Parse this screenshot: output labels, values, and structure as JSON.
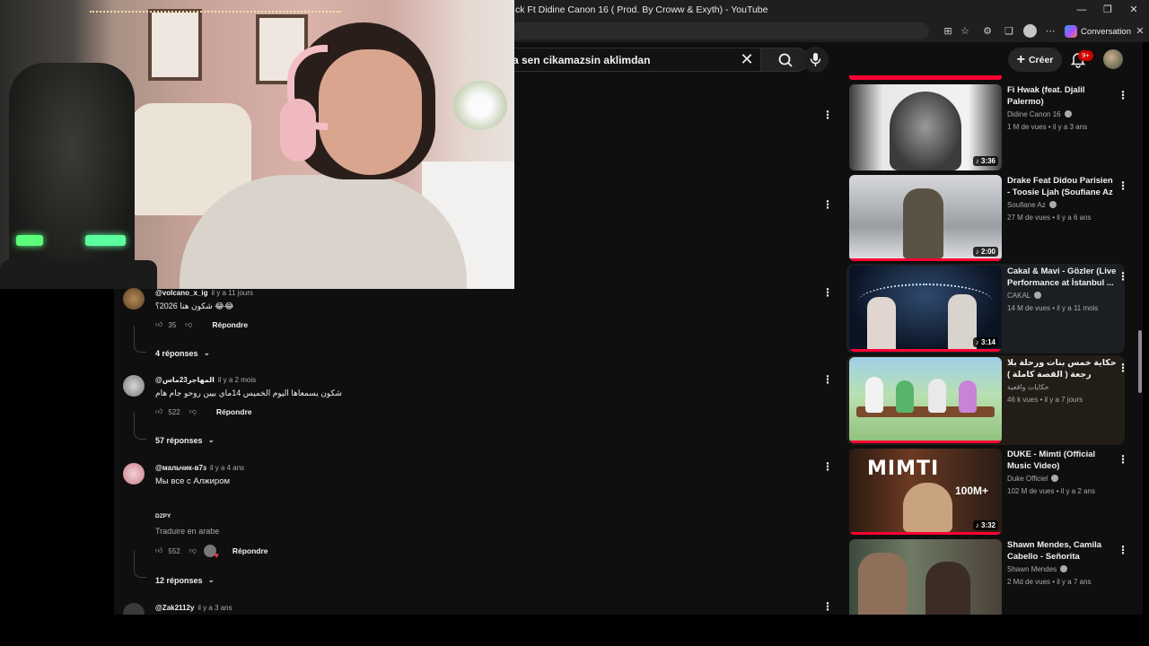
{
  "browser": {
    "tab_title": "ck Ft Didine Canon 16 ( Prod. By Croww & Exyth) - YouTube",
    "copilot_label": "Conversation",
    "window_min": "—",
    "window_max": "❐",
    "window_close": "✕"
  },
  "youtube": {
    "search_value": "a sen cikamazsin aklimdan",
    "create_label": "Créer",
    "notif_badge": "9+"
  },
  "comments": [
    {
      "author": "@volcano_x_ig",
      "time": "il y a 11 jours",
      "text": "شكون هنا 2026؟ 😂😂",
      "likes": "35",
      "reply_label": "Répondre",
      "replies": "4 réponses"
    },
    {
      "author": "@المهاجر23ماس",
      "time": "il y a 2 mois",
      "text": "شكون يسمعاها اليوم الخميس 14ماي بيين روحو جام هام",
      "likes": "522",
      "reply_label": "Répondre",
      "replies": "57 réponses"
    },
    {
      "author": "@мальчик-в7з",
      "time": "il y a 4 ans",
      "text": "Мы все с Алжиром",
      "translate_label": "DZPY",
      "translate_link": "Traduire en arabe",
      "likes": "552",
      "reply_label": "Répondre",
      "replies": "12 réponses"
    },
    {
      "author": "@Zak2112y",
      "time": "il y a 3 ans"
    }
  ],
  "recommendations": [
    {
      "title": "Fi Hwak (feat. Djalil Palermo)",
      "channel": "Didine Canon 16",
      "verified": true,
      "meta": "1 M de vues • il y a 3 ans",
      "duration": "♪ 3:36"
    },
    {
      "title": "Drake Feat Didou Parisien - Toosie Ljah (Soufiane Az ...",
      "channel": "Soufiane Az",
      "verified": true,
      "meta": "27 M de vues • il y a 6 ans",
      "duration": "♪ 2:00"
    },
    {
      "title": "Cakal & Mavi - Gözler (Live Performance at İstanbul ...",
      "channel": "CAKAL",
      "verified": true,
      "meta": "14 M de vues • il y a 11 mois",
      "duration": "♪ 3:14"
    },
    {
      "title": "حكاية خمس بنات ورحلة بلا رجعة ( القصة كاملة )",
      "channel": "حكايات واقعية",
      "verified": false,
      "meta": "46 k vues • il y a 7 jours",
      "duration": ""
    },
    {
      "title": "DUKE - Mimti (Official Music Video)",
      "channel": "Duke Officiel",
      "verified": true,
      "meta": "102 M de vues • il y a 2 ans",
      "duration": "♪ 3:32"
    },
    {
      "title": "Shawn Mendes, Camila Cabello - Señorita",
      "channel": "Shawn Mendes",
      "verified": true,
      "meta": "2 Md de vues • il y a 7 ans",
      "duration": ""
    }
  ]
}
